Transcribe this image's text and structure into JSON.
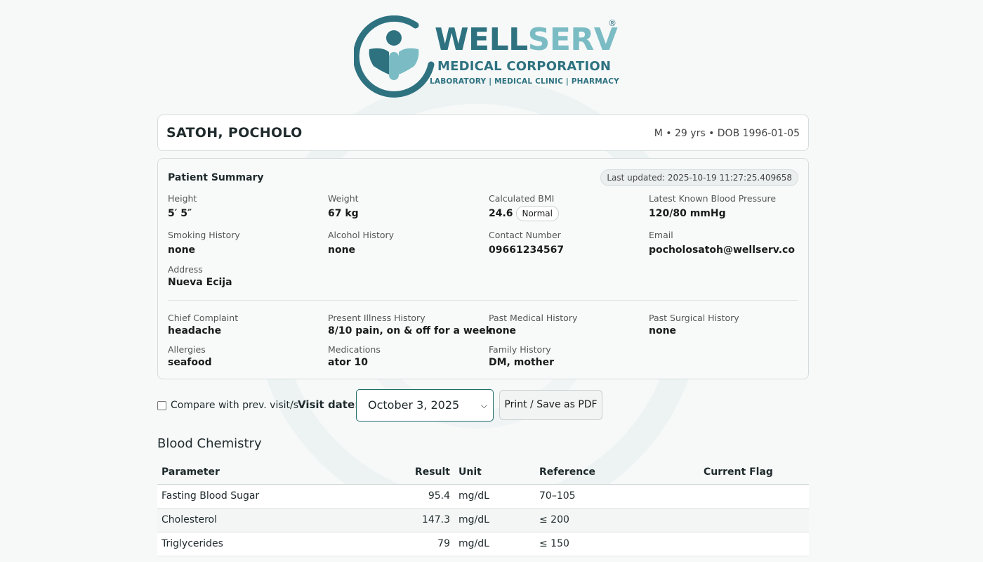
{
  "logo": {
    "name_part1": "WELL",
    "name_part2": "SERV",
    "registered": "®",
    "subtitle": "MEDICAL CORPORATION",
    "tagline": "LABORATORY | MEDICAL CLINIC | PHARMACY",
    "colors": {
      "dark": "#2e7280",
      "light": "#7bbcc4"
    }
  },
  "patient": {
    "name": "SATOH, POCHOLO",
    "meta": "M • 29 yrs • DOB 1996-01-05"
  },
  "summary": {
    "title": "Patient Summary",
    "last_updated": "Last updated: 2025-10-19 11:27:25.409658",
    "height": {
      "label": "Height",
      "value": "5′ 5″"
    },
    "weight": {
      "label": "Weight",
      "value": "67 kg"
    },
    "bmi": {
      "label": "Calculated BMI",
      "value": "24.6",
      "badge": "Normal"
    },
    "bp": {
      "label": "Latest Known Blood Pressure",
      "value": "120/80 mmHg"
    },
    "smoking": {
      "label": "Smoking History",
      "value": "none"
    },
    "alcohol": {
      "label": "Alcohol History",
      "value": "none"
    },
    "contact": {
      "label": "Contact Number",
      "value": "09661234567"
    },
    "email": {
      "label": "Email",
      "value": "pocholosatoh@wellserv.co"
    },
    "address": {
      "label": "Address",
      "value": "Nueva Ecija"
    },
    "chief_complaint": {
      "label": "Chief Complaint",
      "value": "headache"
    },
    "present_illness": {
      "label": "Present Illness History",
      "value": "8/10 pain, on & off for a week"
    },
    "past_medical": {
      "label": "Past Medical History",
      "value": "none"
    },
    "past_surgical": {
      "label": "Past Surgical History",
      "value": "none"
    },
    "allergies": {
      "label": "Allergies",
      "value": "seafood"
    },
    "medications": {
      "label": "Medications",
      "value": "ator 10"
    },
    "family_history": {
      "label": "Family History",
      "value": "DM, mother"
    }
  },
  "controls": {
    "compare_label": "Compare with prev. visit/s",
    "visit_label": "Visit date:",
    "visit_selected": "October 3, 2025",
    "print_label": "Print / Save as PDF"
  },
  "blood_chemistry": {
    "title": "Blood Chemistry",
    "headers": [
      "Parameter",
      "Result",
      "Unit",
      "Reference",
      "Current Flag"
    ],
    "rows": [
      {
        "parameter": "Fasting Blood Sugar",
        "result": "95.4",
        "unit": "mg/dL",
        "reference": "70–105",
        "flag": ""
      },
      {
        "parameter": "Cholesterol",
        "result": "147.3",
        "unit": "mg/dL",
        "reference": "≤ 200",
        "flag": ""
      },
      {
        "parameter": "Triglycerides",
        "result": "79",
        "unit": "mg/dL",
        "reference": "≤ 150",
        "flag": ""
      }
    ]
  }
}
